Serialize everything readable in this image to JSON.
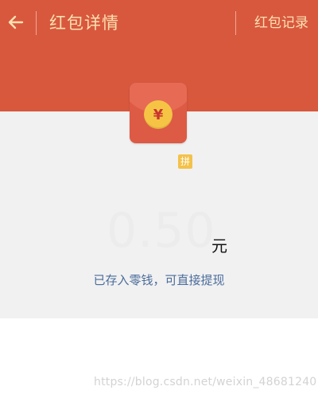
{
  "header": {
    "title": "红包详情",
    "records_label": "红包记录"
  },
  "packet": {
    "sender_name": "",
    "badge": "拼",
    "amount": "0.50",
    "currency": "元",
    "note": "已存入零钱，可直接提现"
  },
  "colors": {
    "header_red": "#d8583e",
    "header_text": "#fbe0b0",
    "link_blue": "#4a6c9b",
    "coin_gold": "#f6c445"
  },
  "footer": {
    "watermark": "https://blog.csdn.net/weixin_48681240"
  }
}
